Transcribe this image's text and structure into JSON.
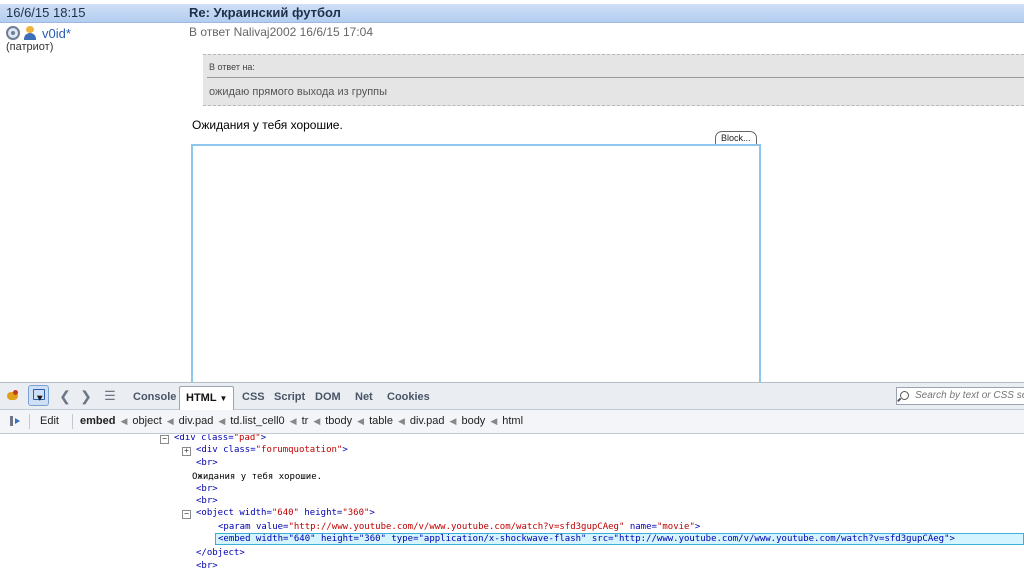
{
  "post": {
    "date": "16/6/15 18:15",
    "title": "Re: Украинский футбол",
    "username": "v0id*",
    "user_status": "(патриот)",
    "reply_info": "В ответ Nalivaj2002 16/6/15 17:04",
    "quote_label": "В ответ на:",
    "quote_text": "ожидаю прямого выхода из группы",
    "body_text": "Ожидания у тебя хорошие.",
    "block_label": "Block..."
  },
  "devtools": {
    "tabs": [
      "Console",
      "HTML",
      "CSS",
      "Script",
      "DOM",
      "Net",
      "Cookies"
    ],
    "active_tab": "HTML",
    "search_placeholder": "Search by text or CSS selector",
    "edit_label": "Edit",
    "breadcrumbs": [
      "embed",
      "object",
      "div.pad",
      "td.list_cell0",
      "tr",
      "tbody",
      "table",
      "div.pad",
      "body",
      "html"
    ],
    "tree": {
      "div_pad": "<div class=\"pad\">",
      "div_pad_tag": "div",
      "div_pad_attr": "class",
      "div_pad_val": "\"pad\"",
      "forumquote_tag": "div",
      "forumquote_attr": "class",
      "forumquote_val": "\"forumquotation\"",
      "br": "<br>",
      "text_node": "Ожидания у тебя хорошие.",
      "object_tag": "object",
      "object_w_attr": "width",
      "object_w_val": "\"640\"",
      "object_h_attr": "height",
      "object_h_val": "\"360\"",
      "param_tag": "param",
      "param_value_attr": "value",
      "param_value_val": "\"http://www.youtube.com/v/www.youtube.com/watch?v=sfd3gupCAeg\"",
      "param_name_attr": "name",
      "param_name_val": "\"movie\"",
      "embed_line": "<embed width=\"640\" height=\"360\" type=\"application/x-shockwave-flash\" src=\"http://www.youtube.com/v/www.youtube.com/watch?v=sfd3gupCAeg\">",
      "object_close": "</object>"
    }
  }
}
